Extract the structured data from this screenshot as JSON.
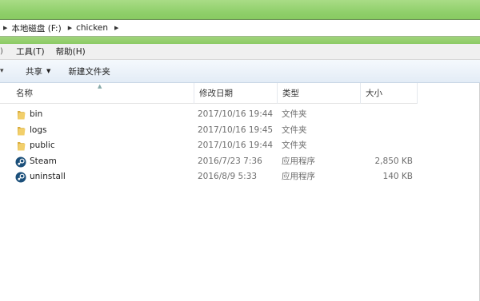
{
  "address": {
    "crumbs": [
      "本地磁盘 (F:)",
      "chicken"
    ]
  },
  "menu": {
    "items": [
      "工具(T)",
      "帮助(H)"
    ]
  },
  "toolbar": {
    "share_label": "共享",
    "new_folder_label": "新建文件夹"
  },
  "columns": {
    "name": "名称",
    "date": "修改日期",
    "type": "类型",
    "size": "大小"
  },
  "files": [
    {
      "name": "bin",
      "date": "2017/10/16 19:44",
      "type": "文件夹",
      "size": "",
      "icon": "folder-icon"
    },
    {
      "name": "logs",
      "date": "2017/10/16 19:45",
      "type": "文件夹",
      "size": "",
      "icon": "folder-icon"
    },
    {
      "name": "public",
      "date": "2017/10/16 19:44",
      "type": "文件夹",
      "size": "",
      "icon": "folder-icon"
    },
    {
      "name": "Steam",
      "date": "2016/7/23 7:36",
      "type": "应用程序",
      "size": "2,850 KB",
      "icon": "steam-icon"
    },
    {
      "name": "uninstall",
      "date": "2016/8/9 5:33",
      "type": "应用程序",
      "size": "140 KB",
      "icon": "steam-icon"
    }
  ],
  "colors": {
    "accent": "#8fcf6a",
    "folder": "#e8c25a",
    "steam": "#1b4f7a"
  }
}
